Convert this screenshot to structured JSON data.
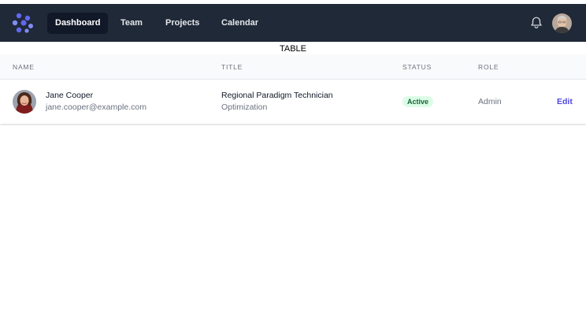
{
  "colors": {
    "topbar_bg": "#1f2937",
    "nav_active_bg": "#111827",
    "accent": "#6366f1",
    "link": "#4f46e5",
    "badge_bg": "#dcfce7",
    "badge_text": "#166534"
  },
  "navbar": {
    "logo_icon": "logo-icon",
    "items": [
      {
        "label": "Dashboard",
        "active": true
      },
      {
        "label": "Team",
        "active": false
      },
      {
        "label": "Projects",
        "active": false
      },
      {
        "label": "Calendar",
        "active": false
      }
    ],
    "notifications_icon": "bell-icon",
    "user_avatar_icon": "user-avatar"
  },
  "section_label": "TABLE",
  "table": {
    "headers": {
      "name": "NAME",
      "title": "TITLE",
      "status": "STATUS",
      "role": "ROLE"
    },
    "rows": [
      {
        "name": "Jane Cooper",
        "email": "jane.cooper@example.com",
        "title": "Regional Paradigm Technician",
        "department": "Optimization",
        "status": "Active",
        "role": "Admin",
        "action": "Edit"
      }
    ]
  }
}
